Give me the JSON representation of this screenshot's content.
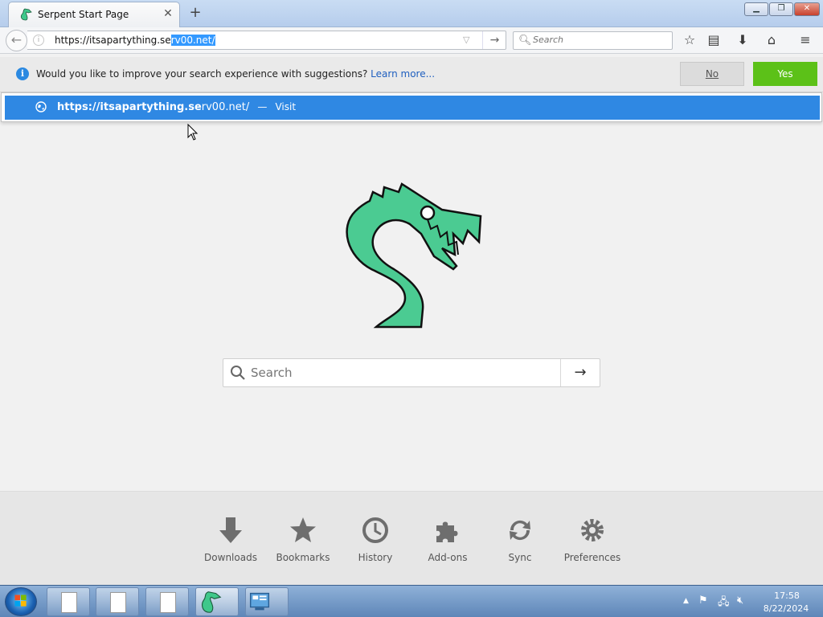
{
  "browser": {
    "tab_title": "Serpent Start Page",
    "tab_close": "✕",
    "new_tab": "+",
    "window_controls": {
      "minimize": "▁",
      "maximize": "❐",
      "close": "✕"
    }
  },
  "urlbar": {
    "url_typed": "https://itsapartything.se",
    "url_selected": "rv00.net/",
    "go": "→"
  },
  "searchbar": {
    "placeholder": "Search"
  },
  "notification": {
    "icon": "i",
    "message": "Would you like to improve your search experience with suggestions?",
    "link": "Learn more...",
    "no": "No",
    "yes": "Yes"
  },
  "autocomplete": {
    "url_bold": "https://itsapartything.se",
    "url_rest": "rv00.net/",
    "separator": "—",
    "action": "Visit"
  },
  "main_search": {
    "placeholder": "Search",
    "go": "→"
  },
  "launcher": {
    "items": [
      {
        "label": "Downloads",
        "icon": "download-icon"
      },
      {
        "label": "Bookmarks",
        "icon": "star-icon"
      },
      {
        "label": "History",
        "icon": "clock-icon"
      },
      {
        "label": "Add-ons",
        "icon": "puzzle-icon"
      },
      {
        "label": "Sync",
        "icon": "sync-icon"
      },
      {
        "label": "Preferences",
        "icon": "gear-icon"
      }
    ]
  },
  "taskbar": {
    "time": "17:58",
    "date": "8/22/2024"
  },
  "colors": {
    "accent_blue": "#2f88e3",
    "yes_green": "#5cc118",
    "logo_green": "#3fc88b"
  }
}
